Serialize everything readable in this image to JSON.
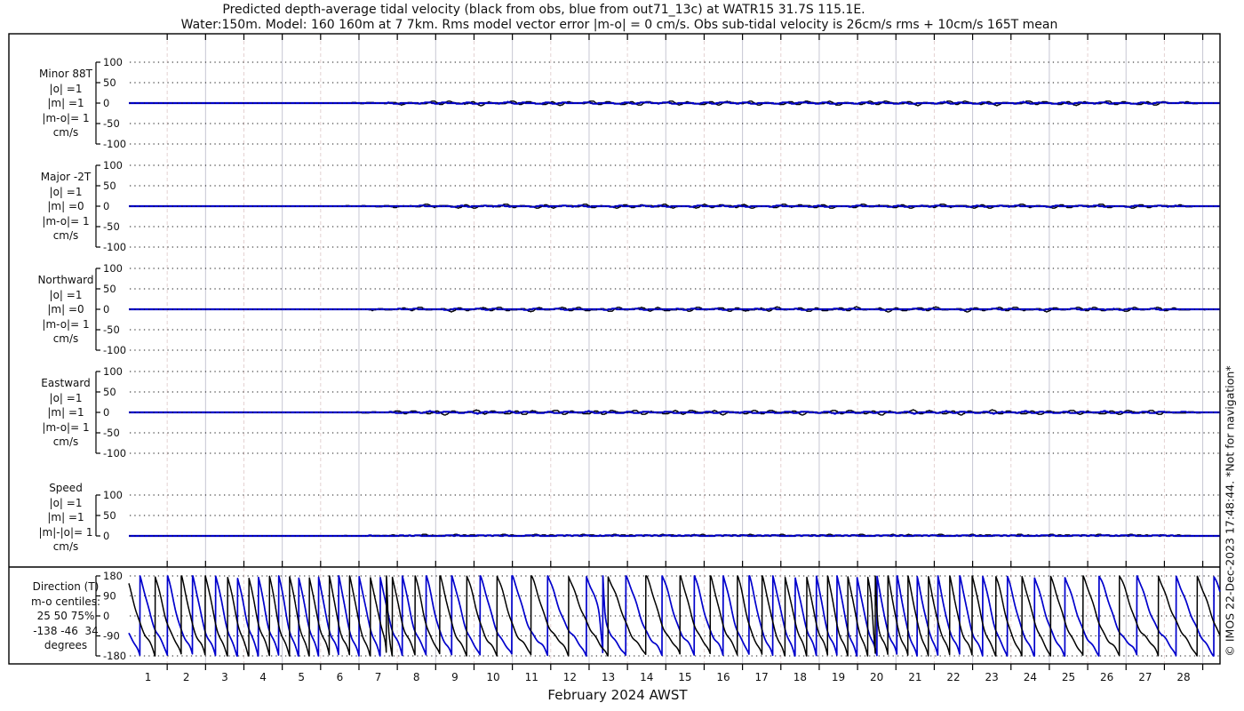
{
  "title": {
    "line1": "Predicted depth-average tidal velocity (black from obs, blue from out71_13c) at WATR15 31.7S 115.1E.",
    "line2": "Water:150m. Model: 160 160m at 7 7km. Rms model vector error |m-o| = 0 cm/s. Obs sub-tidal velocity is 26cm/s rms + 10cm/s 165T mean"
  },
  "footer": {
    "month": "February 2024 AWST"
  },
  "watermark": "© IMOS 22-Dec-2023 17:48:44. *Not for navigation*",
  "colors": {
    "obs": "#000000",
    "model": "#0000cc",
    "frame": "#000000",
    "grid_dot": "#1a1a1a",
    "grid_day_odd": "#e4d2d2",
    "grid_day_even": "#c7c7d3"
  },
  "chart_data": {
    "type": "line",
    "x": {
      "label": "February 2024 AWST",
      "start_day": 0,
      "end_day": 28.45,
      "day_ticks": [
        1,
        2,
        3,
        4,
        5,
        6,
        7,
        8,
        9,
        10,
        11,
        12,
        13,
        14,
        15,
        16,
        17,
        18,
        19,
        20,
        21,
        22,
        23,
        24,
        25,
        26,
        27,
        28
      ],
      "day_labels": [
        "1",
        "2",
        "3",
        "4",
        "5",
        "6",
        "7",
        "8",
        "9",
        "10",
        "11",
        "12",
        "13",
        "14",
        "15",
        "16",
        "17",
        "18",
        "19",
        "20",
        "21",
        "22",
        "23",
        "24",
        "25",
        "26",
        "27",
        "28"
      ]
    },
    "panels": [
      {
        "id": "minor",
        "label_lines": [
          "Minor 88T",
          "|o| =1",
          "|m| =1",
          "|m-o|= 1",
          "cm/s"
        ],
        "unit": "cm/s",
        "ylim": [
          -115,
          115
        ],
        "yticks": [
          100,
          50,
          0,
          -50,
          -100
        ],
        "series": [
          {
            "name": "obs",
            "color": "#000000",
            "summary": "flat near 0 cm/s, rms 1",
            "gen": {
              "kind": "flat_noise",
              "amp": 2.9,
              "phase": 0.0
            }
          },
          {
            "name": "model",
            "color": "#0000cc",
            "summary": "flat near 0 cm/s, rms 1",
            "gen": {
              "kind": "flat_noise",
              "amp": 1.2,
              "phase": 1.3
            }
          }
        ]
      },
      {
        "id": "major",
        "label_lines": [
          "Major -2T",
          "|o| =1",
          "|m| =0",
          "|m-o|= 1",
          "cm/s"
        ],
        "unit": "cm/s",
        "ylim": [
          -115,
          115
        ],
        "yticks": [
          100,
          50,
          0,
          -50,
          -100
        ],
        "series": [
          {
            "name": "obs",
            "color": "#000000",
            "summary": "flat near 0 cm/s, rms 1",
            "gen": {
              "kind": "flat_noise",
              "amp": 2.7,
              "phase": 1.7
            }
          },
          {
            "name": "model",
            "color": "#0000cc",
            "summary": "flat near 0 cm/s, rms 0",
            "gen": {
              "kind": "flat_noise",
              "amp": 0.8,
              "phase": 2.9
            }
          }
        ]
      },
      {
        "id": "northward",
        "label_lines": [
          "Northward",
          "|o| =1",
          "|m| =0",
          "|m-o|= 1",
          "cm/s"
        ],
        "unit": "cm/s",
        "ylim": [
          -115,
          115
        ],
        "yticks": [
          100,
          50,
          0,
          -50,
          -100
        ],
        "series": [
          {
            "name": "obs",
            "color": "#000000",
            "summary": "flat near 0 cm/s, rms 1",
            "gen": {
              "kind": "flat_noise",
              "amp": 3.0,
              "phase": 3.4
            }
          },
          {
            "name": "model",
            "color": "#0000cc",
            "summary": "flat near 0 cm/s, rms 0",
            "gen": {
              "kind": "flat_noise",
              "amp": 0.8,
              "phase": 4.6
            }
          }
        ]
      },
      {
        "id": "eastward",
        "label_lines": [
          "Eastward",
          "|o| =1",
          "|m| =1",
          "|m-o|= 1",
          "cm/s"
        ],
        "unit": "cm/s",
        "ylim": [
          -115,
          115
        ],
        "yticks": [
          100,
          50,
          0,
          -50,
          -100
        ],
        "series": [
          {
            "name": "obs",
            "color": "#000000",
            "summary": "flat near 0 cm/s, rms 1",
            "gen": {
              "kind": "flat_noise",
              "amp": 3.1,
              "phase": 5.1
            }
          },
          {
            "name": "model",
            "color": "#0000cc",
            "summary": "flat near 0 cm/s, rms 1",
            "gen": {
              "kind": "flat_noise",
              "amp": 1.3,
              "phase": 0.8
            }
          }
        ]
      },
      {
        "id": "speed",
        "label_lines": [
          "Speed",
          "|o| =1",
          "|m| =1",
          "|m|-|o|= 1",
          "cm/s"
        ],
        "unit": "cm/s",
        "ylim": [
          0,
          115
        ],
        "yticks": [
          100,
          50,
          0
        ],
        "series": [
          {
            "name": "obs",
            "color": "#000000",
            "summary": "flat near 0 cm/s, rms 1",
            "gen": {
              "kind": "flat_noise_abs",
              "amp": 2.6,
              "phase": 2.2
            }
          },
          {
            "name": "model",
            "color": "#0000cc",
            "summary": "flat near 0 cm/s, rms 1",
            "gen": {
              "kind": "flat_noise_abs",
              "amp": 1.1,
              "phase": 4.0
            }
          }
        ]
      },
      {
        "id": "direction",
        "label_lines": [
          "Direction (T)",
          "m-o centiles:",
          "25 50 75%",
          "-138 -46  34",
          "degrees"
        ],
        "unit": "degrees",
        "ylim": [
          -180,
          180
        ],
        "yticks": [
          180,
          90,
          0,
          -90,
          -180
        ],
        "mo_centiles": {
          "percentiles": [
            25,
            50,
            75
          ],
          "values_deg": [
            -138,
            -46,
            34
          ]
        },
        "tide_rate_cycles_per_day": {
          "mean": 1.45,
          "mod_amp": 0.48,
          "mod_period_days": 14.77,
          "mod_center_day": 12
        },
        "series": [
          {
            "name": "model",
            "color": "#0000cc",
            "summary": "wrapped tidal phase, -180..180 deg, semidiurnal to diurnal",
            "gen": {
              "kind": "wrapped_sawtooth",
              "phase0": 0.62,
              "wigphase": 0.9,
              "glitch_days": [
                12.35
              ]
            }
          },
          {
            "name": "obs",
            "color": "#000000",
            "summary": "wrapped tidal phase, -180..180 deg, semidiurnal to diurnal",
            "gen": {
              "kind": "wrapped_sawtooth",
              "phase0": 0.08,
              "wigphase": 3.8,
              "glitch_days": [
                6.75,
                19.45
              ]
            }
          }
        ]
      }
    ]
  }
}
